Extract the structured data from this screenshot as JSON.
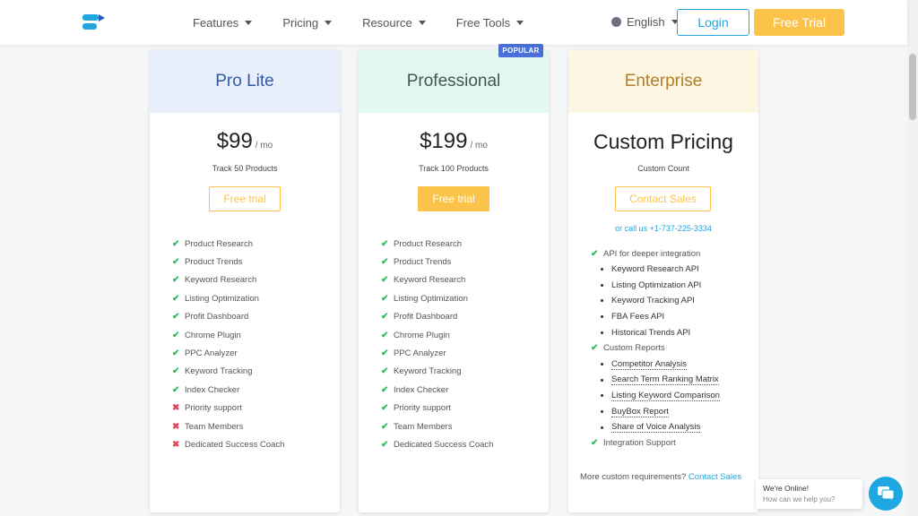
{
  "header": {
    "nav": [
      {
        "label": "Features"
      },
      {
        "label": "Pricing"
      },
      {
        "label": "Resource"
      },
      {
        "label": "Free Tools"
      }
    ],
    "language": "English",
    "login": "Login",
    "free_trial": "Free Trial"
  },
  "plans": [
    {
      "name": "Pro Lite",
      "price": "$99",
      "unit": "/ mo",
      "sub": "Track 50 Products",
      "cta": "Free trial",
      "features": [
        {
          "label": "Product Research",
          "ok": true
        },
        {
          "label": "Product Trends",
          "ok": true
        },
        {
          "label": "Keyword Research",
          "ok": true
        },
        {
          "label": "Listing Optimization",
          "ok": true
        },
        {
          "label": "Profit Dashboard",
          "ok": true
        },
        {
          "label": "Chrome Plugin",
          "ok": true
        },
        {
          "label": "PPC Analyzer",
          "ok": true
        },
        {
          "label": "Keyword Tracking",
          "ok": true
        },
        {
          "label": "Index Checker",
          "ok": true
        },
        {
          "label": "Priority support",
          "ok": false
        },
        {
          "label": "Team Members",
          "ok": false
        },
        {
          "label": "Dedicated Success Coach",
          "ok": false
        }
      ]
    },
    {
      "name": "Professional",
      "badge": "POPULAR",
      "price": "$199",
      "unit": "/ mo",
      "sub": "Track 100 Products",
      "cta": "Free trial",
      "features": [
        {
          "label": "Product Research",
          "ok": true
        },
        {
          "label": "Product Trends",
          "ok": true
        },
        {
          "label": "Keyword Research",
          "ok": true
        },
        {
          "label": "Listing Optimization",
          "ok": true
        },
        {
          "label": "Profit Dashboard",
          "ok": true
        },
        {
          "label": "Chrome Plugin",
          "ok": true
        },
        {
          "label": "PPC Analyzer",
          "ok": true
        },
        {
          "label": "Keyword Tracking",
          "ok": true
        },
        {
          "label": "Index Checker",
          "ok": true
        },
        {
          "label": "Priority support",
          "ok": true
        },
        {
          "label": "Team Members",
          "ok": true
        },
        {
          "label": "Dedicated Success Coach",
          "ok": true
        }
      ]
    },
    {
      "name": "Enterprise",
      "price": "Custom Pricing",
      "sub": "Custom Count",
      "cta": "Contact Sales",
      "call": "or call us +1-737-225-3334",
      "groups": [
        {
          "label": "API for deeper integration",
          "items": [
            "Keyword Research API",
            "Listing Optimization API",
            "Keyword Tracking API",
            "FBA Fees API",
            "Historical Trends API"
          ]
        },
        {
          "label": "Custom Reports",
          "items": [
            "Competitor Analysis",
            "Search Term Ranking Matrix",
            "Listing Keyword Comparison",
            "BuyBox Report",
            "Share of Voice Analysis"
          ]
        },
        {
          "label": "Integration Support",
          "items": []
        }
      ],
      "more_text": "More custom requirements?",
      "more_link": "Contact Sales"
    }
  ],
  "chat": {
    "title": "We're Online!",
    "subtitle": "How can we help you?"
  },
  "colors": {
    "accent": "#1ea7e0",
    "cta": "#fcc34a",
    "check": "#2ebb5e",
    "cross": "#e2455a",
    "badge": "#4a6fd6"
  }
}
